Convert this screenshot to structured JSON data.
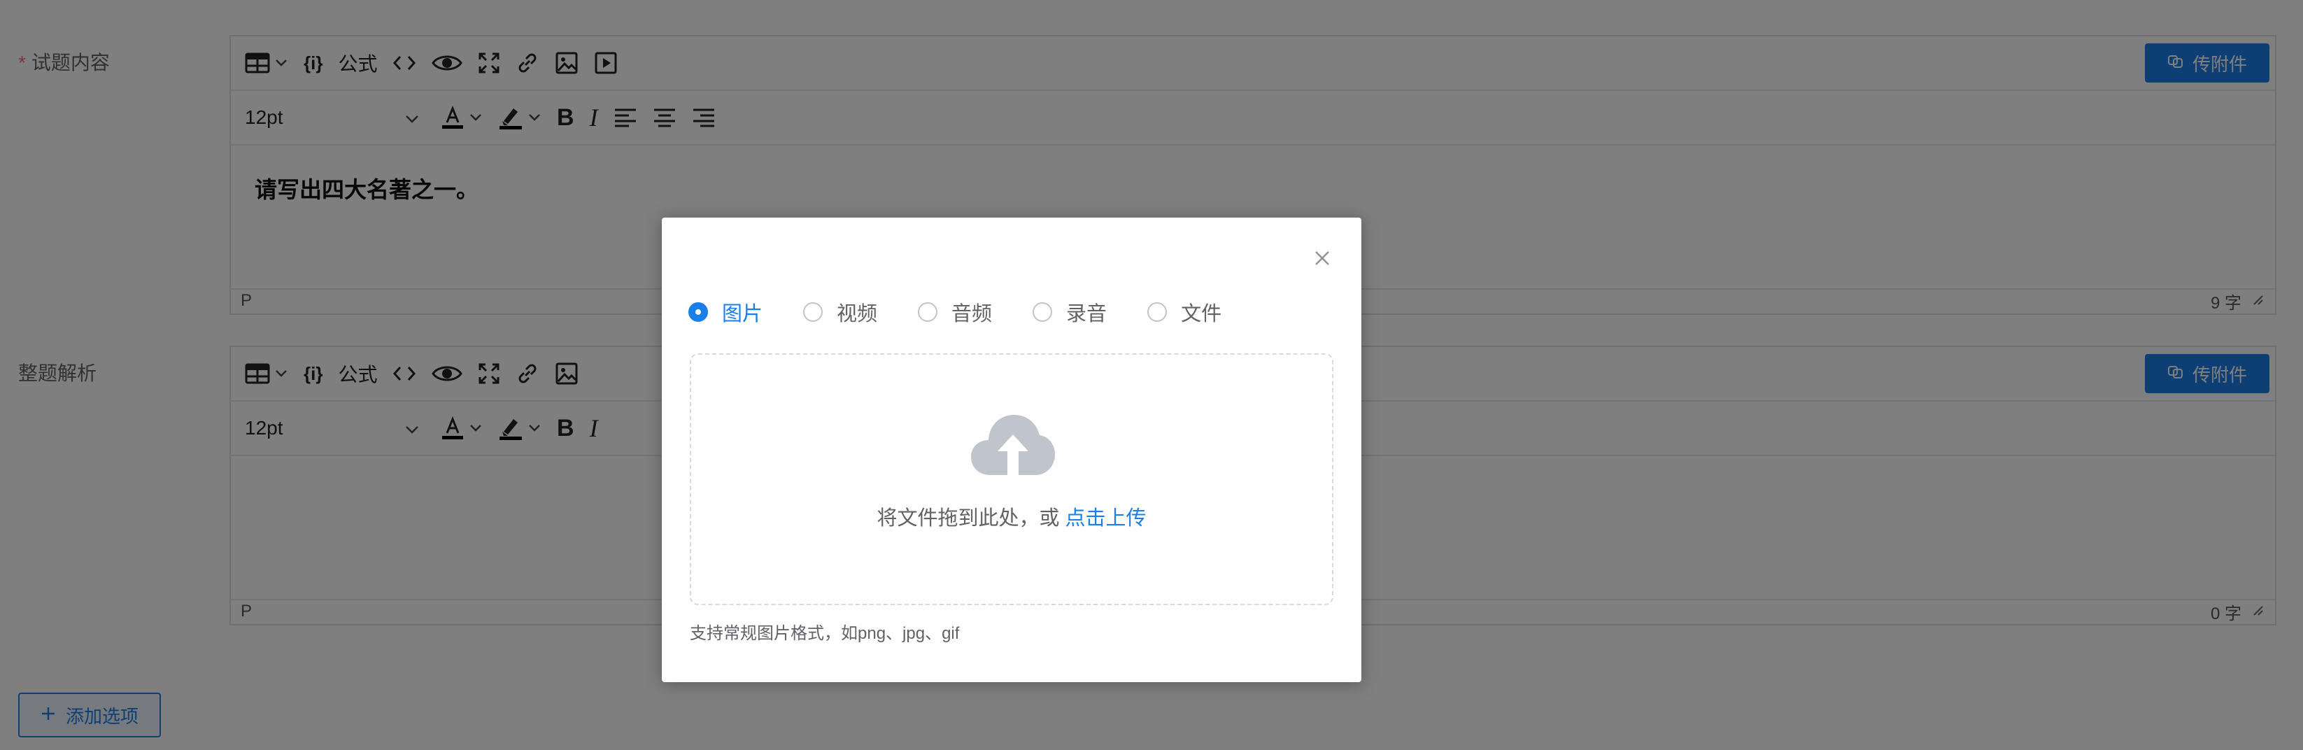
{
  "question_content": {
    "label": "试题内容",
    "required_mark": "*",
    "toolbar": {
      "formula_label": "公式",
      "font_size": "12pt",
      "attach_label": "传附件"
    },
    "content": "请写出四大名著之一。",
    "status_tag": "P",
    "word_count": "9 字"
  },
  "analysis": {
    "label": "整题解析",
    "toolbar": {
      "formula_label": "公式",
      "font_size": "12pt",
      "attach_label": "传附件"
    },
    "content": "",
    "status_tag": "P",
    "word_count": "0 字"
  },
  "add_option_label": "添加选项",
  "dialog": {
    "tabs": [
      {
        "label": "图片",
        "checked": true
      },
      {
        "label": "视频",
        "checked": false
      },
      {
        "label": "音频",
        "checked": false
      },
      {
        "label": "录音",
        "checked": false
      },
      {
        "label": "文件",
        "checked": false
      }
    ],
    "upload_prompt": "将文件拖到此处，或",
    "upload_link": "点击上传",
    "upload_tip": "支持常规图片格式，如png、jpg、gif"
  },
  "colors": {
    "primary": "#1a7fe8",
    "required": "#f56c6c",
    "overlay": "rgba(0,0,0,0.5)",
    "cloud_icon": "#c0c4cc"
  }
}
